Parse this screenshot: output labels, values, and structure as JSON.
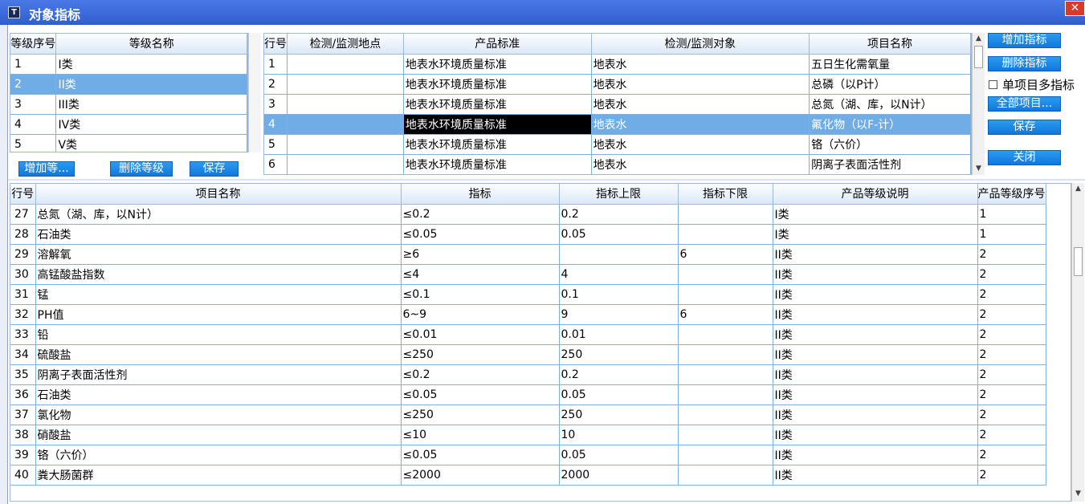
{
  "window": {
    "title": "对象指标",
    "close": "✕",
    "icon_glyph": "T"
  },
  "grade_grid": {
    "headers": [
      "等级序号",
      "等级名称"
    ],
    "rows": [
      [
        "1",
        "I类"
      ],
      [
        "2",
        "II类"
      ],
      [
        "3",
        "III类"
      ],
      [
        "4",
        "IV类"
      ],
      [
        "5",
        "V类"
      ]
    ],
    "selected_index": 1
  },
  "grade_buttons": {
    "add": "增加等...",
    "delete": "删除等级",
    "save": "保存"
  },
  "standard_grid": {
    "headers": [
      "行号",
      "检测/监测地点",
      "产品标准",
      "检测/监测对象",
      "项目名称"
    ],
    "rows": [
      [
        "1",
        "",
        "地表水环境质量标准",
        "地表水",
        "五日生化需氧量"
      ],
      [
        "2",
        "",
        "地表水环境质量标准",
        "地表水",
        "总磷（以P计）"
      ],
      [
        "3",
        "",
        "地表水环境质量标准",
        "地表水",
        "总氮（湖、库，以N计）"
      ],
      [
        "4",
        "",
        "地表水环境质量标准",
        "地表水",
        "氟化物（以F-计）"
      ],
      [
        "5",
        "",
        "地表水环境质量标准",
        "地表水",
        "铬（六价）"
      ],
      [
        "6",
        "",
        "地表水环境质量标准",
        "地表水",
        "阴离子表面活性剂"
      ]
    ],
    "selected_index": 3
  },
  "right_panel": {
    "add_indicator": "增加指标",
    "delete_indicator": "删除指标",
    "multi_checkbox": "单项目多指标",
    "all_items": "全部项目...",
    "save": "保存",
    "close": "关闭"
  },
  "indicator_grid": {
    "headers": [
      "行号",
      "项目名称",
      "指标",
      "指标上限",
      "指标下限",
      "产品等级说明",
      "产品等级序号"
    ],
    "rows": [
      [
        "27",
        "总氮（湖、库，以N计）",
        "≤0.2",
        "0.2",
        "",
        "I类",
        "1"
      ],
      [
        "28",
        "石油类",
        "≤0.05",
        "0.05",
        "",
        "I类",
        "1"
      ],
      [
        "29",
        "溶解氧",
        "≥6",
        "",
        "6",
        "II类",
        "2"
      ],
      [
        "30",
        "高锰酸盐指数",
        "≤4",
        "4",
        "",
        "II类",
        "2"
      ],
      [
        "31",
        "锰",
        "≤0.1",
        "0.1",
        "",
        "II类",
        "2"
      ],
      [
        "32",
        "PH值",
        "6~9",
        "9",
        "6",
        "II类",
        "2"
      ],
      [
        "33",
        "铅",
        "≤0.01",
        "0.01",
        "",
        "II类",
        "2"
      ],
      [
        "34",
        "硫酸盐",
        "≤250",
        "250",
        "",
        "II类",
        "2"
      ],
      [
        "35",
        "阴离子表面活性剂",
        "≤0.2",
        "0.2",
        "",
        "II类",
        "2"
      ],
      [
        "36",
        "石油类",
        "≤0.05",
        "0.05",
        "",
        "II类",
        "2"
      ],
      [
        "37",
        "氯化物",
        "≤250",
        "250",
        "",
        "II类",
        "2"
      ],
      [
        "38",
        "硝酸盐",
        "≤10",
        "10",
        "",
        "II类",
        "2"
      ],
      [
        "39",
        "铬（六价）",
        "≤0.05",
        "0.05",
        "",
        "II类",
        "2"
      ],
      [
        "40",
        "粪大肠菌群",
        "≤2000",
        "2000",
        "",
        "II类",
        "2"
      ]
    ]
  },
  "colors": {
    "titlebar": "#2f5fcf",
    "selection": "#70ade6",
    "button": "#1a88e6",
    "grid_line": "#7fb0df"
  }
}
